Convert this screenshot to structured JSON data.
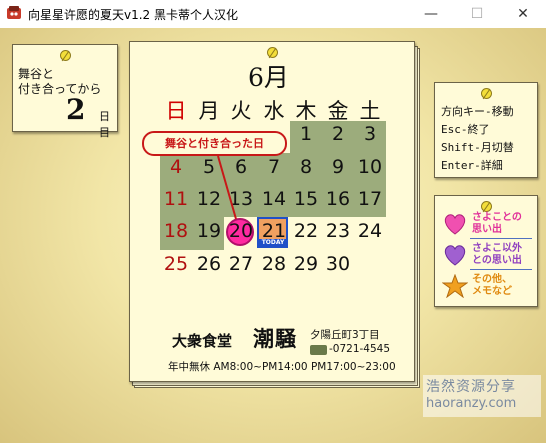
{
  "window": {
    "title": "向星星许愿的夏天v1.2 黑卡蒂个人汉化",
    "minimize_glyph": "—",
    "maximize_glyph": "☐",
    "close_glyph": "✕"
  },
  "anniversary": {
    "label_line1": "舞谷と",
    "label_line2": "付き合ってから",
    "count": "2",
    "unit": "日目"
  },
  "calendar": {
    "month": "6月",
    "weekdays": [
      "日",
      "月",
      "火",
      "水",
      "木",
      "金",
      "土"
    ],
    "weeks": [
      [
        "",
        "",
        "",
        "",
        "1",
        "2",
        "3"
      ],
      [
        "4",
        "5",
        "6",
        "7",
        "8",
        "9",
        "10"
      ],
      [
        "11",
        "12",
        "13",
        "14",
        "15",
        "16",
        "17"
      ],
      [
        "18",
        "19",
        "20",
        "21",
        "22",
        "23",
        "24"
      ],
      [
        "25",
        "26",
        "27",
        "28",
        "29",
        "30",
        ""
      ]
    ],
    "selected_day": "20",
    "today_day": "21",
    "today_label": "TODAY",
    "callout": "舞谷と付き合った日",
    "colors": {
      "past_block": "#9cac7c",
      "selected": "#ff2aa0",
      "today": "#f0a060",
      "today_border": "#2050c8",
      "sunday": "#b01010"
    }
  },
  "footer": {
    "shop_name": "大衆食堂",
    "logo": "潮騒",
    "address": "夕陽丘町3丁目",
    "tel": "-0721-4545",
    "hours": "年中無休  AM8:00~PM14:00  PM17:00~23:00"
  },
  "help": {
    "lines": [
      "方向キー-移動",
      "Esc-終了",
      "Shift-月切替",
      "Enter-詳細"
    ]
  },
  "menu": {
    "items": [
      {
        "line1": "さよことの",
        "line2": "思い出",
        "icon": "heart-pink-icon",
        "color": "#e0309a"
      },
      {
        "line1": "さよこ以外",
        "line2": "との思い出",
        "icon": "heart-purple-icon",
        "color": "#9040c0"
      },
      {
        "line1": "その他、",
        "line2": "メモなど",
        "icon": "star-icon",
        "color": "#e08a10"
      }
    ]
  },
  "watermark": {
    "cn": "浩然资源分享",
    "en": "haoranzy.com"
  }
}
